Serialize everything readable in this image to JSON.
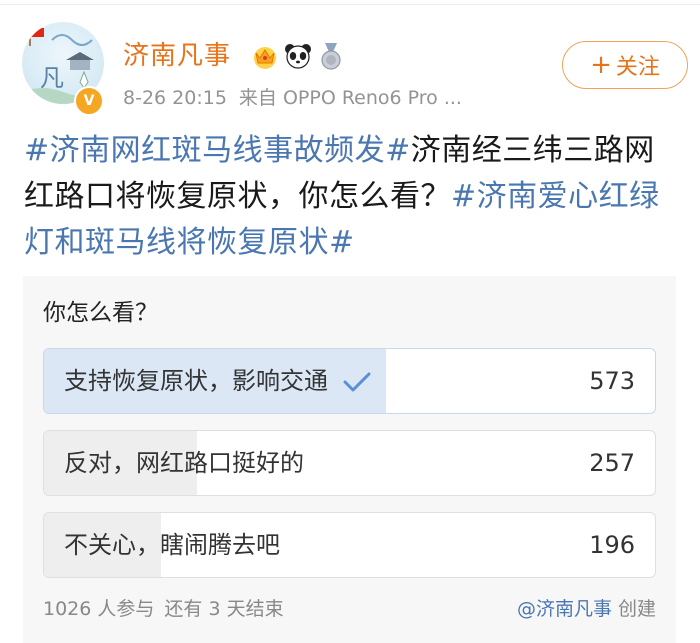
{
  "account": {
    "name": "济南凡事",
    "verified_badge": "V",
    "badges": [
      "crown-icon",
      "panda-icon",
      "medal-icon"
    ]
  },
  "post_meta": {
    "time": "8-26 20:15",
    "source": "来自 OPPO Reno6 Pro ..."
  },
  "follow_button": {
    "plus": "+",
    "label": "关注"
  },
  "post": {
    "hashtag1": "#济南网红斑马线事故频发#",
    "text": "济南经三纬三路网红路口将恢复原状，你怎么看？",
    "hashtag2": "#济南爱心红绿灯和斑马线将恢复原状#"
  },
  "poll": {
    "question": "你怎么看？",
    "options": [
      {
        "label": "支持恢复原状，影响交通",
        "count": "573",
        "selected": true,
        "share": 0.559
      },
      {
        "label": "反对，网红路口挺好的",
        "count": "257",
        "selected": false,
        "share": 0.251
      },
      {
        "label": "不关心，瞎闹腾去吧",
        "count": "196",
        "selected": false,
        "share": 0.191
      }
    ],
    "participants": "1026 人参与",
    "remaining": "还有 3 天结束",
    "creator_prefix": "@",
    "creator_name": "济南凡事",
    "creator_suffix": " 创建"
  },
  "colors": {
    "accent_orange": "#e8741a",
    "link_blue": "#4a77b1",
    "selected_fill": "#dbe7f5",
    "check_blue": "#5b8fd8"
  }
}
